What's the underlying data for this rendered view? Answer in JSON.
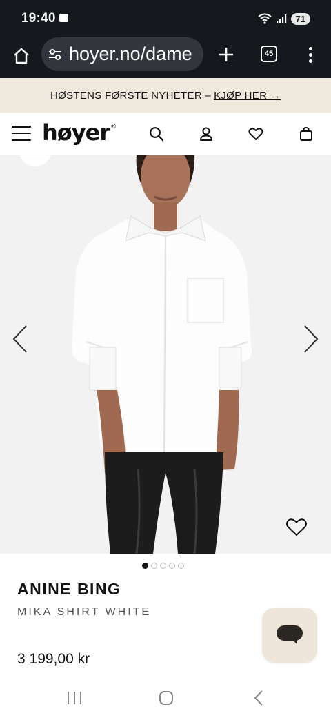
{
  "status_bar": {
    "time": "19:40",
    "battery": "71"
  },
  "browser": {
    "url": "hoyer.no/dame",
    "tab_count": "45"
  },
  "promo": {
    "text": "HØSTENS FØRSTE NYHETER –",
    "link": "KJØP HER →"
  },
  "header": {
    "logo": "høyer",
    "logo_mark": "®"
  },
  "gallery": {
    "image_count": 5,
    "active_index": 0
  },
  "product": {
    "brand": "ANINE BING",
    "name": "MIKA SHIRT WHITE",
    "price": "3 199,00 kr"
  },
  "colors": {
    "status_bg": "#15181d",
    "promo_bg": "#efe9dd",
    "image_bg": "#f2f2f2",
    "chat_bg": "#efe6db",
    "chat_icon": "#2a2622"
  }
}
